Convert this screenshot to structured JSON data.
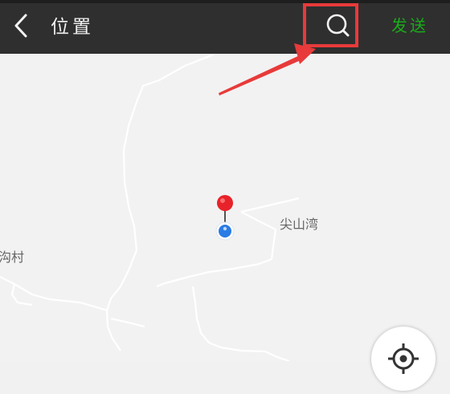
{
  "header": {
    "back_icon": "chevron-left-icon",
    "title": "位置",
    "search_icon": "search-icon",
    "send_label": "发送"
  },
  "map": {
    "labels": [
      "尖山湾",
      "沟村"
    ],
    "pin_icon": "location-pin-icon",
    "current_location_icon": "current-location-dot-icon",
    "locate_button_icon": "locate-crosshair-icon"
  },
  "annotation": {
    "highlight_color": "#e83a3a",
    "arrow_icon": "annotation-arrow-icon"
  },
  "colors": {
    "header_background": "#2f2f2f",
    "send_accent": "#1aad19",
    "map_background": "#f2f2f2",
    "pin_red": "#e8222a",
    "location_blue": "#2a7be4"
  }
}
